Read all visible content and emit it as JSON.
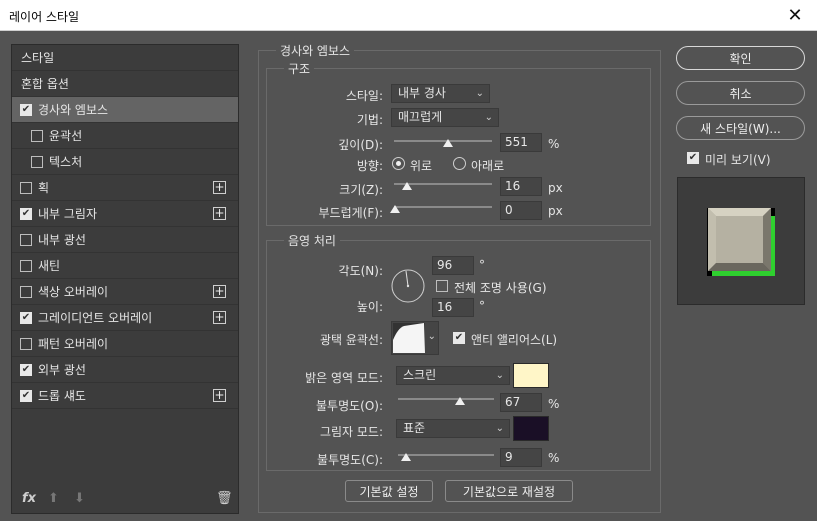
{
  "window": {
    "title": "레이어 스타일",
    "close_glyph": "✕"
  },
  "left_panel": {
    "header_items": [
      "스타일",
      "혼합 옵션"
    ],
    "items": [
      {
        "label": "경사와 엠보스",
        "checked": true,
        "selected": true,
        "has_plus": false,
        "indent": false
      },
      {
        "label": "윤곽선",
        "checked": false,
        "selected": false,
        "has_plus": false,
        "indent": true
      },
      {
        "label": "텍스처",
        "checked": false,
        "selected": false,
        "has_plus": false,
        "indent": true
      },
      {
        "label": "획",
        "checked": false,
        "selected": false,
        "has_plus": true,
        "indent": false
      },
      {
        "label": "내부 그림자",
        "checked": true,
        "selected": false,
        "has_plus": true,
        "indent": false
      },
      {
        "label": "내부 광선",
        "checked": false,
        "selected": false,
        "has_plus": false,
        "indent": false
      },
      {
        "label": "새틴",
        "checked": false,
        "selected": false,
        "has_plus": false,
        "indent": false
      },
      {
        "label": "색상 오버레이",
        "checked": false,
        "selected": false,
        "has_plus": true,
        "indent": false
      },
      {
        "label": "그레이디언트 오버레이",
        "checked": true,
        "selected": false,
        "has_plus": true,
        "indent": false
      },
      {
        "label": "패턴 오버레이",
        "checked": false,
        "selected": false,
        "has_plus": false,
        "indent": false
      },
      {
        "label": "외부 광선",
        "checked": true,
        "selected": false,
        "has_plus": false,
        "indent": false
      },
      {
        "label": "드롭 섀도",
        "checked": true,
        "selected": false,
        "has_plus": true,
        "indent": false
      }
    ],
    "bottom": {
      "fx": "fx",
      "up": "⬆",
      "down": "⬇",
      "trash": "🗑"
    }
  },
  "bevel": {
    "group_title": "경사와 엠보스",
    "structure": {
      "title": "구조",
      "style_label": "스타일:",
      "style_value": "내부 경사",
      "technique_label": "기법:",
      "technique_value": "매끄럽게",
      "depth_label": "깊이(D):",
      "depth_value": "551",
      "depth_unit": "%",
      "direction_label": "방향:",
      "direction_up": "위로",
      "direction_down": "아래로",
      "size_label": "크기(Z):",
      "size_value": "16",
      "size_unit": "px",
      "soften_label": "부드럽게(F):",
      "soften_value": "0",
      "soften_unit": "px"
    },
    "shading": {
      "title": "음영 처리",
      "angle_label": "각도(N):",
      "angle_value": "96",
      "degree": "°",
      "global_light_label": "전체 조명 사용(G)",
      "altitude_label": "높이:",
      "altitude_value": "16",
      "gloss_label": "광택 윤곽선:",
      "antialias_label": "앤티 앨리어스(L)",
      "highlight_mode_label": "밝은 영역 모드:",
      "highlight_mode_value": "스크린",
      "highlight_color": "#fff6c8",
      "highlight_opacity_label": "불투명도(O):",
      "highlight_opacity_value": "67",
      "shadow_mode_label": "그림자 모드:",
      "shadow_mode_value": "표준",
      "shadow_color": "#1a0f26",
      "shadow_opacity_label": "불투명도(C):",
      "shadow_opacity_value": "9",
      "percent": "%"
    },
    "make_default": "기본값 설정",
    "reset_default": "기본값으로 재설정"
  },
  "right": {
    "ok": "확인",
    "cancel": "취소",
    "new_style": "새 스타일(W)...",
    "preview_label": "미리 보기(V)",
    "preview_checked": true
  }
}
